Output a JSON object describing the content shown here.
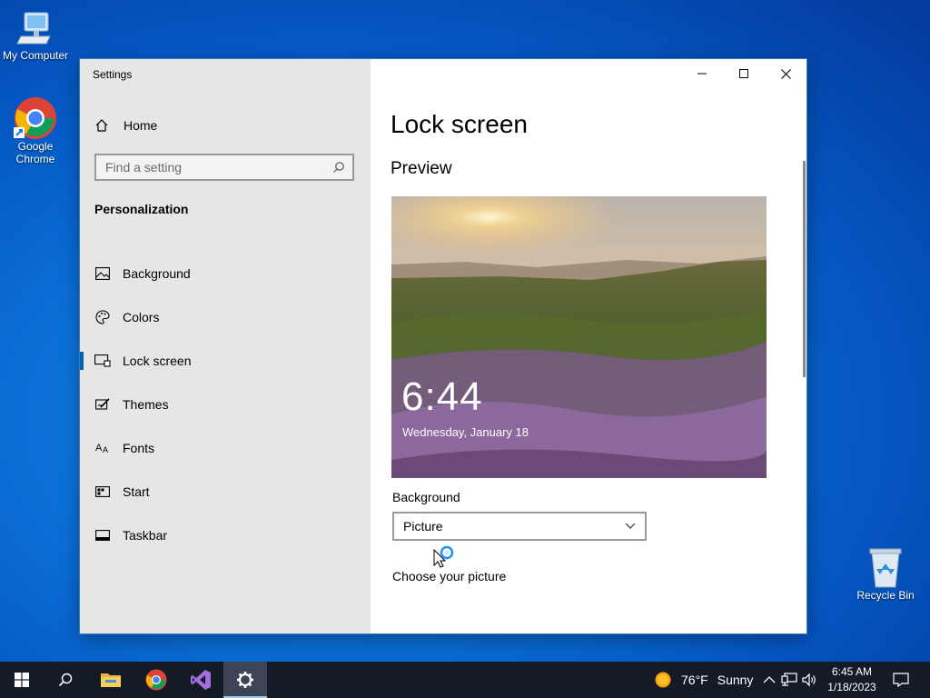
{
  "desktop": {
    "icons": [
      {
        "label": "My Computer"
      },
      {
        "label_line1": "Google",
        "label_line2": "Chrome"
      },
      {
        "label": "Recycle Bin"
      }
    ]
  },
  "window": {
    "title": "Settings",
    "sidebar": {
      "home_label": "Home",
      "search_placeholder": "Find a setting",
      "section_title": "Personalization",
      "items": [
        {
          "label": "Background",
          "icon": "image-icon"
        },
        {
          "label": "Colors",
          "icon": "palette-icon"
        },
        {
          "label": "Lock screen",
          "icon": "lock-screen-icon",
          "active": true
        },
        {
          "label": "Themes",
          "icon": "themes-icon"
        },
        {
          "label": "Fonts",
          "icon": "fonts-icon"
        },
        {
          "label": "Start",
          "icon": "start-icon"
        },
        {
          "label": "Taskbar",
          "icon": "taskbar-icon"
        }
      ]
    },
    "content": {
      "page_title": "Lock screen",
      "preview_heading": "Preview",
      "preview_time": "6:44",
      "preview_date": "Wednesday, January 18",
      "background_label": "Background",
      "background_value": "Picture",
      "choose_label": "Choose your picture"
    }
  },
  "taskbar": {
    "apps": [
      "start-icon",
      "search-icon",
      "file-explorer-icon",
      "chrome-icon",
      "visual-studio-icon",
      "settings-icon"
    ],
    "weather": {
      "temp": "76°F",
      "condition": "Sunny"
    },
    "clock": {
      "time": "6:45 AM",
      "date": "1/18/2023"
    }
  },
  "colors": {
    "accent": "#0063b1",
    "taskbar": "#141b26",
    "sidebar": "#e6e6e6"
  }
}
